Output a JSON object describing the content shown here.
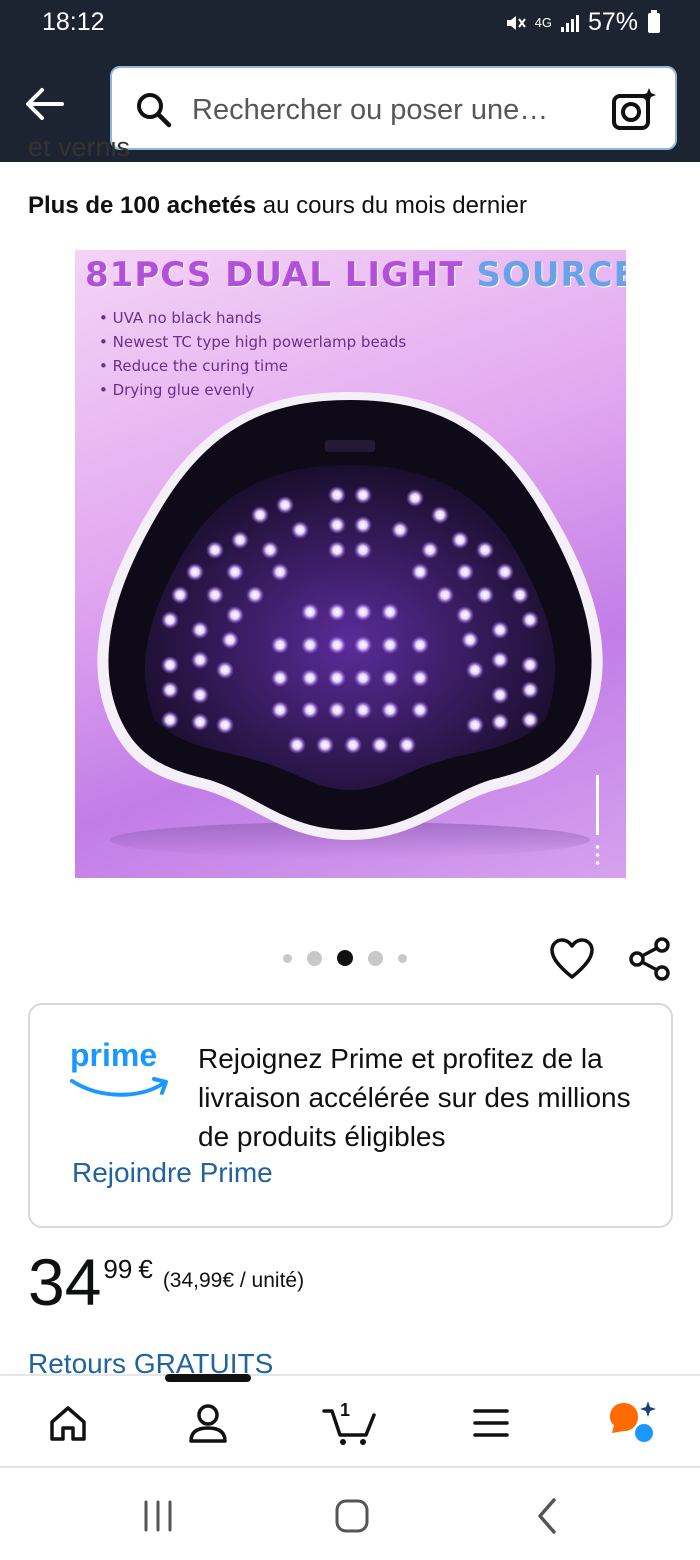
{
  "status_bar": {
    "time": "18:12",
    "network": "4G",
    "battery": "57%"
  },
  "header": {
    "search_placeholder": "Rechercher ou poser une…"
  },
  "cut_text": "et vernis",
  "purchase_info": {
    "bold": "Plus de 100 achetés",
    "rest": " au cours du mois dernier"
  },
  "product_image": {
    "headline_part1": "81PCS DUAL LIGHT ",
    "headline_part2": "SOURCE",
    "bullets": [
      "UVA no black hands",
      "Newest TC type high powerlamp beads",
      "Reduce the curing time",
      "Drying glue evenly"
    ]
  },
  "carousel": {
    "total": 5,
    "active_index": 2
  },
  "prime": {
    "logo_text": "prime",
    "message": "Rejoignez Prime et profitez de la livraison accélérée sur des millions de produits éligibles",
    "link": "Rejoindre Prime"
  },
  "price": {
    "whole": "34",
    "fraction": "99",
    "currency": "€",
    "unit_price": "(34,99€ / unité)"
  },
  "returns": "Retours GRATUITS",
  "bottom_nav": {
    "cart_count": "1"
  },
  "colors": {
    "header_bg": "#1d2431",
    "link_blue": "#2162a1",
    "prime_blue": "#1a98ff",
    "assistant_orange": "#ff6b00"
  }
}
